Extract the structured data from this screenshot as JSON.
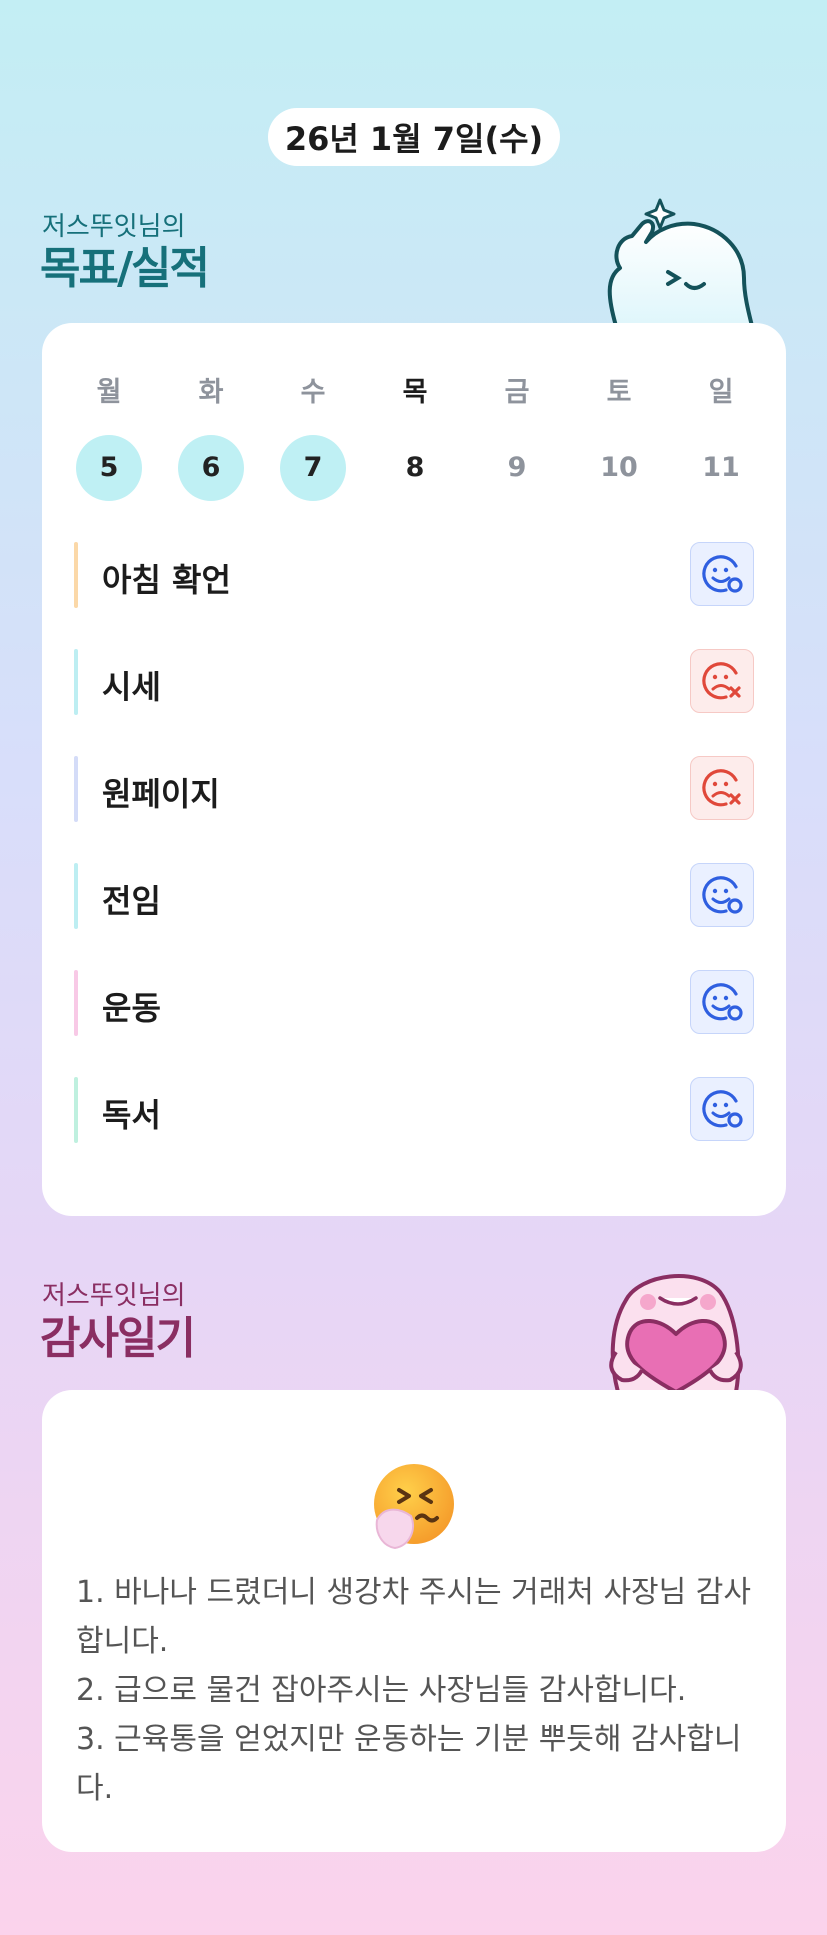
{
  "header": {
    "date": "26년 1월 7일(수)"
  },
  "goals_section": {
    "owner_line": "저스뚜잇님의",
    "title": "목표/실적",
    "week": [
      {
        "weekday": "월",
        "day": "5",
        "state": "done"
      },
      {
        "weekday": "화",
        "day": "6",
        "state": "done"
      },
      {
        "weekday": "수",
        "day": "7",
        "state": "done"
      },
      {
        "weekday": "목",
        "day": "8",
        "state": "today"
      },
      {
        "weekday": "금",
        "day": "9",
        "state": "future"
      },
      {
        "weekday": "토",
        "day": "10",
        "state": "future"
      },
      {
        "weekday": "일",
        "day": "11",
        "state": "future"
      }
    ],
    "goals": [
      {
        "label": "아침 확언",
        "bar_color": "#fbd8a8",
        "status": "achieved",
        "icon": "smile-check-icon"
      },
      {
        "label": "시세",
        "bar_color": "#bdeef2",
        "status": "missed",
        "icon": "sad-x-icon"
      },
      {
        "label": "원페이지",
        "bar_color": "#d4dcf8",
        "status": "missed",
        "icon": "sad-x-icon"
      },
      {
        "label": "전임",
        "bar_color": "#bdeef2",
        "status": "achieved",
        "icon": "smile-check-icon"
      },
      {
        "label": "운동",
        "bar_color": "#f8c9e6",
        "status": "achieved",
        "icon": "smile-check-icon"
      },
      {
        "label": "독서",
        "bar_color": "#bff0df",
        "status": "achieved",
        "icon": "smile-check-icon"
      }
    ]
  },
  "gratitude_section": {
    "owner_line": "저스뚜잇님의",
    "title": "감사일기",
    "mood_icon": "sneezing-face-icon",
    "entries": [
      "1. 바나나 드렸더니 생강차 주시는 거래처 사장님 감사합니다.",
      "2. 급으로 물건 잡아주시는 사장님들 감사합니다.",
      "3. 근육통을 얻었지만 운동하는 기분 뿌듯해 감사합니다."
    ]
  },
  "colors": {
    "accent_teal": "#16707a",
    "accent_plum": "#8a2e62",
    "done_day": "#bff0f4",
    "achieved": "#2f5fe0",
    "missed": "#e0483a"
  }
}
